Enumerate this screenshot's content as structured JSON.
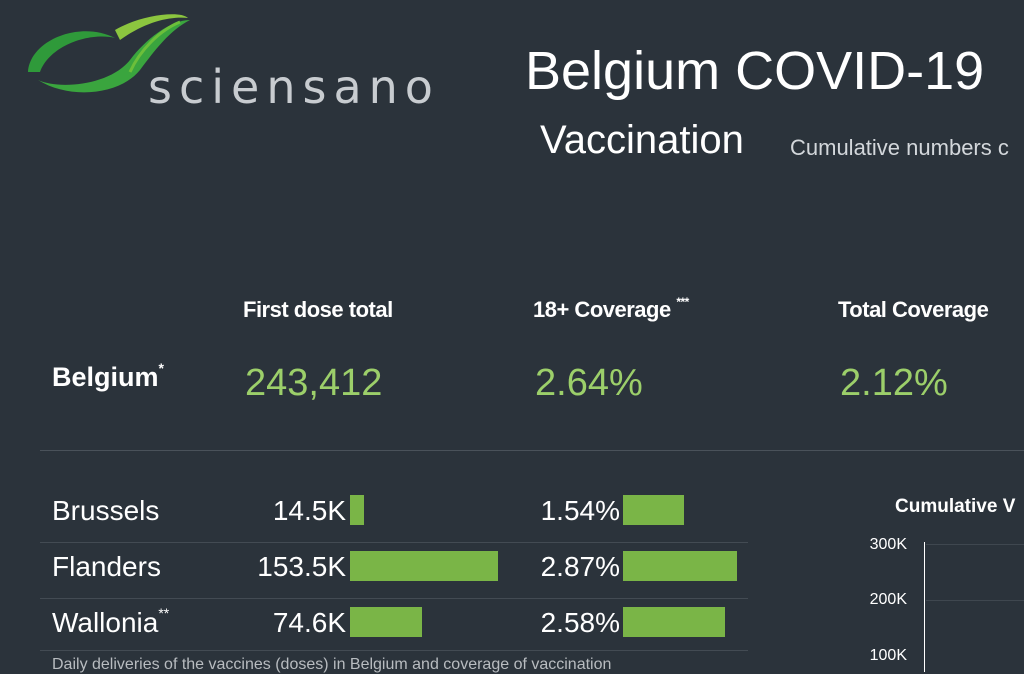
{
  "brand": {
    "name": "sciensano"
  },
  "header": {
    "title": "Belgium COVID-19",
    "subtitle": "Vaccination",
    "note": "Cumulative numbers c"
  },
  "summary": {
    "columns": [
      "First dose total",
      "18+ Coverage",
      "Total Coverage"
    ],
    "column_marks": [
      "",
      "***",
      ""
    ],
    "region": "Belgium",
    "region_mark": "*",
    "first_dose_total": "243,412",
    "adult_coverage": "2.64%",
    "total_coverage": "2.12%"
  },
  "regions": [
    {
      "name": "Brussels",
      "mark": "",
      "first_dose": "14.5K",
      "first_dose_value": 14.5,
      "coverage": "1.54%",
      "coverage_value": 1.54
    },
    {
      "name": "Flanders",
      "mark": "",
      "first_dose": "153.5K",
      "first_dose_value": 153.5,
      "coverage": "2.87%",
      "coverage_value": 2.87
    },
    {
      "name": "Wallonia",
      "mark": "**",
      "first_dose": "74.6K",
      "first_dose_value": 74.6,
      "coverage": "2.58%",
      "coverage_value": 2.58
    }
  ],
  "cumulative_chart": {
    "title": "Cumulative V",
    "y_ticks": [
      "300K",
      "200K",
      "100K"
    ]
  },
  "footer": {
    "text": "Daily deliveries of the vaccines (doses) in Belgium and coverage of vaccination"
  },
  "colors": {
    "accent": "#9ccf6a",
    "bar": "#7ab547",
    "background": "#2b333b"
  }
}
